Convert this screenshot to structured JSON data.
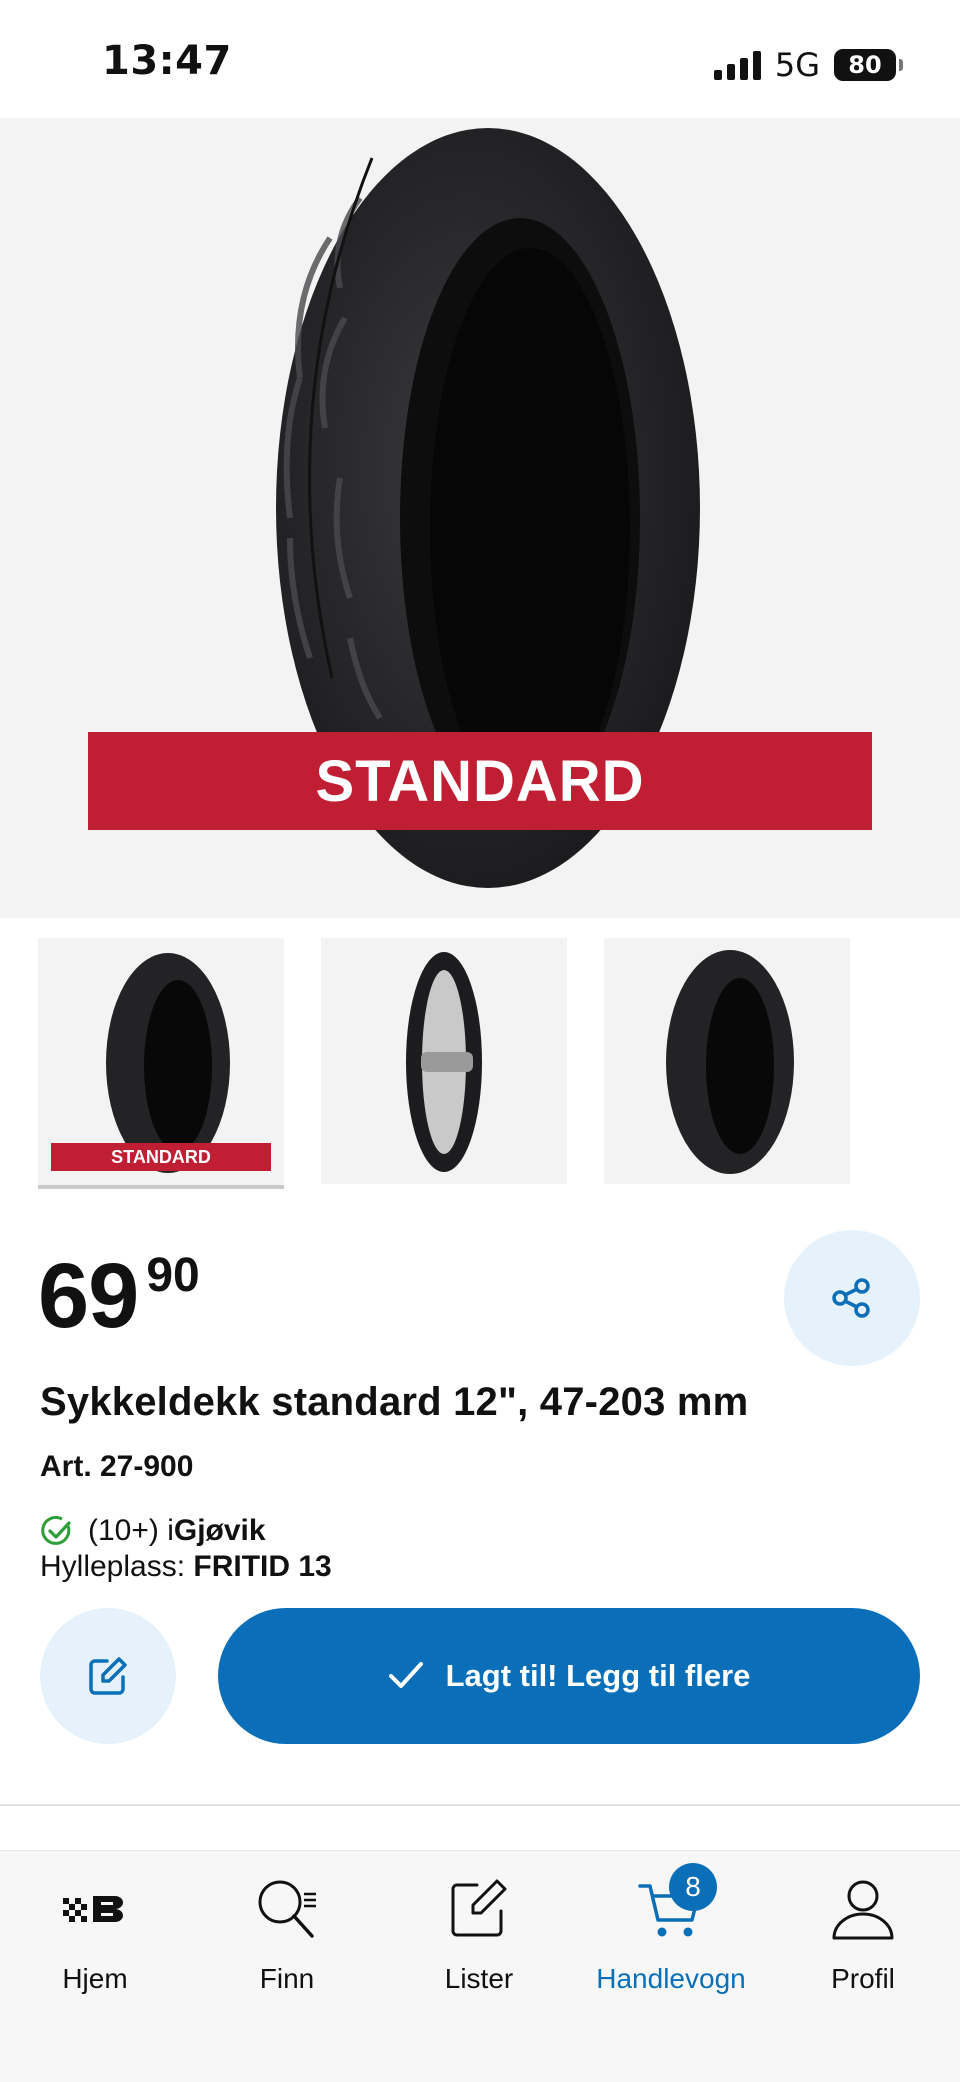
{
  "status_bar": {
    "time": "13:47",
    "network": "5G",
    "battery": "80"
  },
  "product": {
    "hero_banner": "STANDARD",
    "thumb_banner": "STANDARD",
    "price_main": "69",
    "price_cents": "90",
    "title": "Sykkeldekk standard 12\", 47-203 mm",
    "article": "Art. 27-900",
    "stock_count": "(10+) i ",
    "stock_store": "Gjøvik",
    "shelf_label": "Hylleplass: ",
    "shelf_value": "FRITID 13",
    "cart_button_label": "Lagt til! Legg til flere"
  },
  "bottom_nav": {
    "items": [
      {
        "label": "Hjem",
        "icon": "home-logo-icon"
      },
      {
        "label": "Finn",
        "icon": "search-icon"
      },
      {
        "label": "Lister",
        "icon": "edit-list-icon"
      },
      {
        "label": "Handlevogn",
        "icon": "cart-icon",
        "badge": "8",
        "active": true
      },
      {
        "label": "Profil",
        "icon": "profile-icon"
      }
    ]
  },
  "colors": {
    "brand_blue": "#0a6fb8",
    "banner_red": "#c01f33",
    "light_blue_bg": "#e6f2fb",
    "check_green": "#2e9e3a"
  }
}
